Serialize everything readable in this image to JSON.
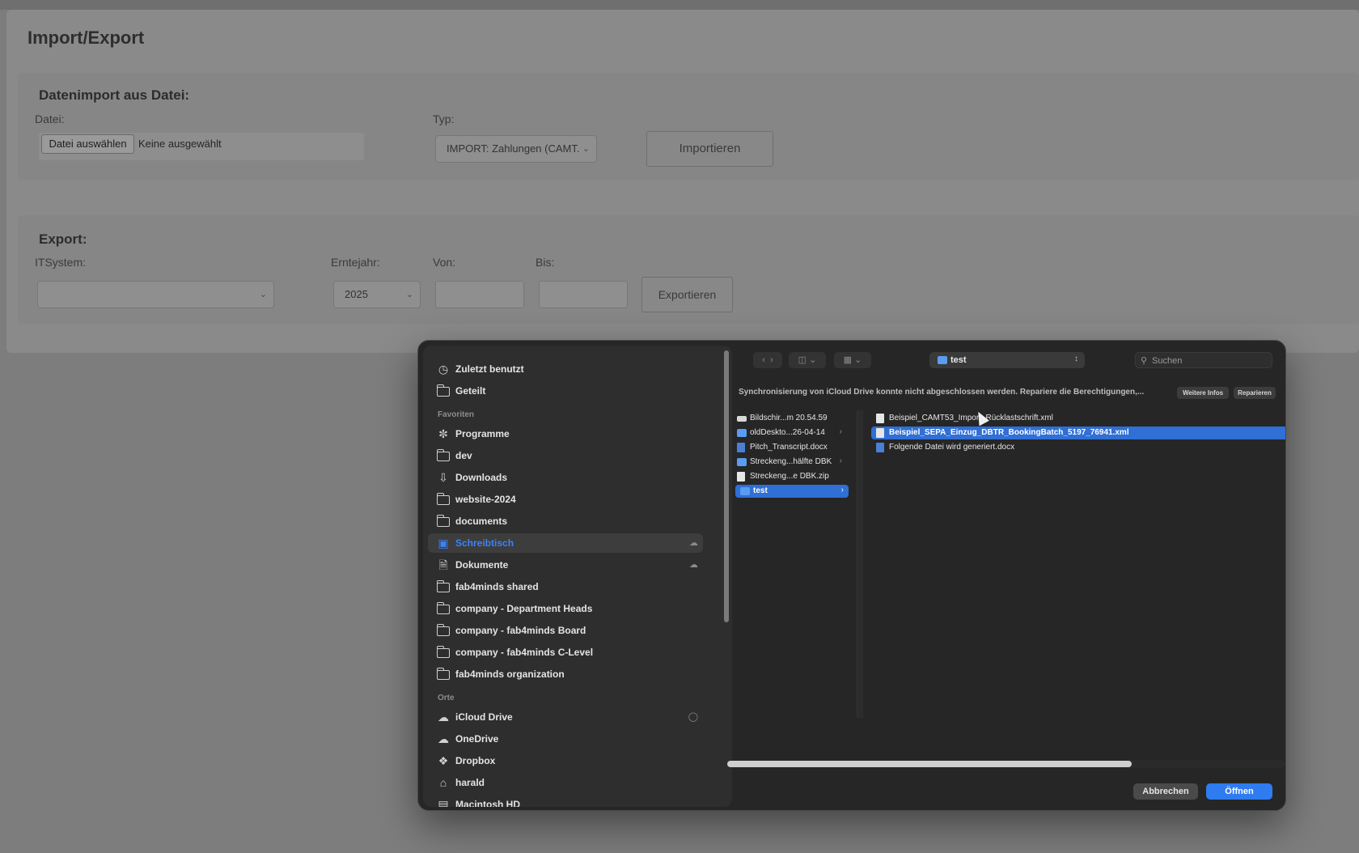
{
  "page": {
    "title": "Import/Export",
    "import": {
      "heading": "Datenimport aus Datei:",
      "file_label": "Datei:",
      "file_button": "Datei auswählen",
      "file_status": "Keine ausgewählt",
      "type_label": "Typ:",
      "type_value": "IMPORT: Zahlungen (CAMT.",
      "submit": "Importieren"
    },
    "export": {
      "heading": "Export:",
      "itsystem_label": "ITSystem:",
      "itsystem_value": "",
      "year_label": "Erntejahr:",
      "year_value": "2025",
      "from_label": "Von:",
      "to_label": "Bis:",
      "submit": "Exportieren"
    }
  },
  "dialog": {
    "sidebar": {
      "top": [
        {
          "label": "Zuletzt benutzt",
          "icon": "clock-icon"
        },
        {
          "label": "Geteilt",
          "icon": "shared-folder-icon"
        }
      ],
      "favorites_heading": "Favoriten",
      "favorites": [
        {
          "label": "Programme",
          "icon": "apps-icon"
        },
        {
          "label": "dev",
          "icon": "folder-icon"
        },
        {
          "label": "Downloads",
          "icon": "download-icon"
        },
        {
          "label": "website-2024",
          "icon": "folder-icon"
        },
        {
          "label": "documents",
          "icon": "folder-icon"
        },
        {
          "label": "Schreibtisch",
          "icon": "desktop-icon",
          "selected": true
        },
        {
          "label": "Dokumente",
          "icon": "document-icon"
        },
        {
          "label": "fab4minds shared",
          "icon": "folder-icon"
        },
        {
          "label": "company - Department Heads",
          "icon": "folder-icon"
        },
        {
          "label": "company - fab4minds Board",
          "icon": "folder-icon"
        },
        {
          "label": "company - fab4minds C-Level",
          "icon": "folder-icon"
        },
        {
          "label": "fab4minds organization",
          "icon": "folder-icon"
        }
      ],
      "places_heading": "Orte",
      "places": [
        {
          "label": "iCloud Drive",
          "icon": "cloud-icon"
        },
        {
          "label": "OneDrive",
          "icon": "onedrive-icon"
        },
        {
          "label": "Dropbox",
          "icon": "dropbox-icon"
        },
        {
          "label": "harald",
          "icon": "home-icon"
        },
        {
          "label": "Macintosh HD",
          "icon": "disk-icon"
        }
      ]
    },
    "toolbar": {
      "location": "test",
      "search_placeholder": "Suchen"
    },
    "warning": {
      "message": "Synchronisierung von iCloud Drive konnte nicht abgeschlossen werden. Repariere die Berechtigungen,...",
      "more_info": "Weitere Infos",
      "repair": "Reparieren"
    },
    "column1": [
      {
        "name": "Bildschir...m 20.54.59",
        "type": "img"
      },
      {
        "name": "oldDeskto...26-04-14",
        "type": "folder",
        "chevron": true
      },
      {
        "name": "Pitch_Transcript.docx",
        "type": "word"
      },
      {
        "name": "Streckeng...hälfte DBK",
        "type": "folder",
        "chevron": true
      },
      {
        "name": "Streckeng...e DBK.zip",
        "type": "doc"
      },
      {
        "name": "test",
        "type": "folder",
        "chevron": true,
        "selected": true
      }
    ],
    "column2": [
      {
        "name": "Beispiel_CAMT53_Import_Rücklastschrift.xml",
        "type": "doc"
      },
      {
        "name": "Beispiel_SEPA_Einzug_DBTR_BookingBatch_5197_76941.xml",
        "type": "doc",
        "selected": true
      },
      {
        "name": "Folgende Datei wird generiert.docx",
        "type": "word"
      }
    ],
    "buttons": {
      "cancel": "Abbrechen",
      "open": "Öffnen"
    },
    "colors": {
      "accent": "#2f7bf0",
      "selection": "#2f6fd6",
      "folder": "#5a9cf0"
    }
  }
}
